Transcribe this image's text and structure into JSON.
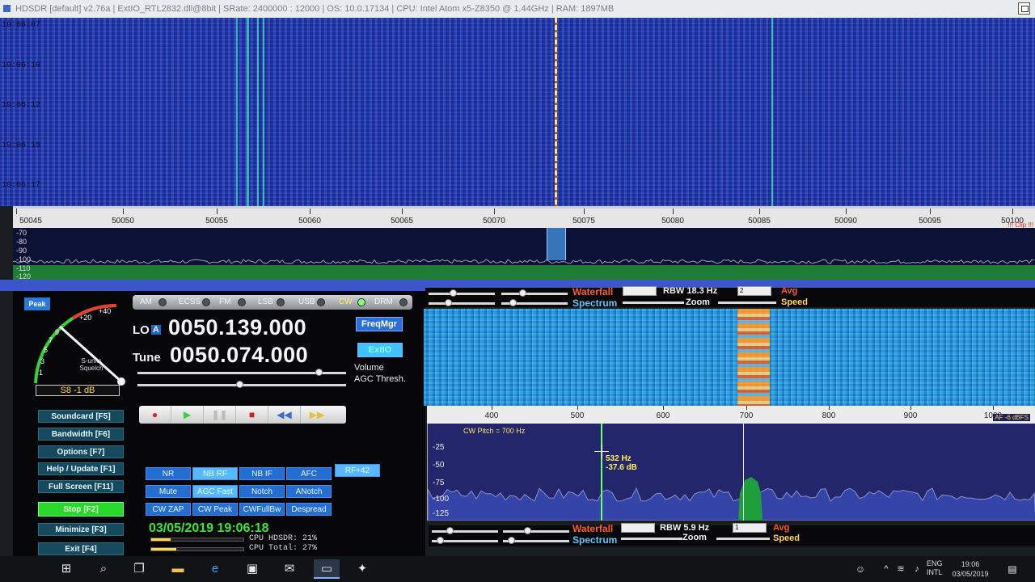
{
  "window": {
    "title": "HDSDR  [default]  v2.76a  |  ExtIO_RTL2832.dll@8bit  |  SRate: 2400000 : 12000  |  OS: 10.0.17134  |  CPU: Intel Atom x5-Z8350 @ 1.44GHz  |  RAM: 1897MB"
  },
  "waterfall_top": {
    "timestamps": [
      "19:06:07",
      "19:06:10",
      "19:06:12",
      "19:06:15",
      "19:06:17"
    ]
  },
  "freq_scale": {
    "labels": [
      "50045",
      "50050",
      "50055",
      "50060",
      "50065",
      "50070",
      "50075",
      "50080",
      "50085",
      "50090",
      "50095",
      "50100"
    ],
    "clip_label": "!!! Clip !!!"
  },
  "spectrum_top": {
    "db_labels": [
      "-70",
      "-80",
      "-90",
      "-100",
      "-110",
      "-120"
    ]
  },
  "smeter": {
    "peak_label": "Peak",
    "scale": [
      "+40",
      "+20",
      "9",
      "7",
      "5",
      "3",
      "1"
    ],
    "caption": "S-units Squelch",
    "readout": "S8 -1 dB"
  },
  "modes": [
    {
      "label": "AM",
      "active": false
    },
    {
      "label": "ECSS",
      "active": false
    },
    {
      "label": "FM",
      "active": false
    },
    {
      "label": "LSB",
      "active": false
    },
    {
      "label": "USB",
      "active": false
    },
    {
      "label": "CW",
      "active": true
    },
    {
      "label": "DRM",
      "active": false
    }
  ],
  "lo": {
    "label": "LO",
    "suffix": "A",
    "freq": "0050.139.000"
  },
  "tune": {
    "label": "Tune",
    "freq": "0050.074.000"
  },
  "buttons": {
    "freqmgr": "FreqMgr",
    "extio": "ExtIO"
  },
  "labels": {
    "volume": "Volume",
    "agc_thresh": "AGC Thresh."
  },
  "transport": [
    "●",
    "▶",
    "❚❚",
    "■",
    "◀◀",
    "▶▶"
  ],
  "menu": [
    "Soundcard  [F5]",
    "Bandwidth  [F6]",
    "Options  [F7]",
    "Help / Update  [F1]",
    "Full Screen  [F11]",
    "Stop  [F2]",
    "Minimize  [F3]",
    "Exit  [F4]"
  ],
  "dsp": [
    [
      "NR",
      "NB RF",
      "NB IF",
      "AFC",
      "RF+42"
    ],
    [
      "Mute",
      "AGC Fast",
      "Notch",
      "ANotch"
    ],
    [
      "CW ZAP",
      "CW Peak",
      "CWFullBw",
      "Despread"
    ]
  ],
  "status": {
    "datetime": "03/05/2019 19:06:18",
    "cpu_hdsdr": "CPU HDSDR: 21%",
    "cpu_total": "CPU Total: 27%",
    "cpu_hdsdr_pct": 21,
    "cpu_total_pct": 27
  },
  "controls_top": {
    "waterfall": "Waterfall",
    "spectrum": "Spectrum",
    "rbw": "RBW 18.3 Hz",
    "zoom": "Zoom",
    "avg": "Avg",
    "speed": "Speed",
    "box2": "2"
  },
  "controls_bottom": {
    "waterfall": "Waterfall",
    "spectrum": "Spectrum",
    "rbw": "RBW  5.9 Hz",
    "zoom": "Zoom",
    "avg": "Avg",
    "speed": "Speed",
    "box1": "1"
  },
  "audio_scale": {
    "labels": [
      "400",
      "500",
      "600",
      "700",
      "800",
      "900",
      "1000"
    ],
    "af_label": "AF -6 dBFS"
  },
  "audio_spec": {
    "db_labels": [
      "-25",
      "-50",
      "-75",
      "-100",
      "-125"
    ],
    "cw_pitch": "CW Pitch = 700 Hz",
    "cursor_freq": "532 Hz",
    "cursor_db": "-37.6 dB"
  },
  "taskbar": {
    "lang1": "ENG",
    "lang2": "INTL",
    "time": "19:06",
    "date": "03/05/2019"
  }
}
